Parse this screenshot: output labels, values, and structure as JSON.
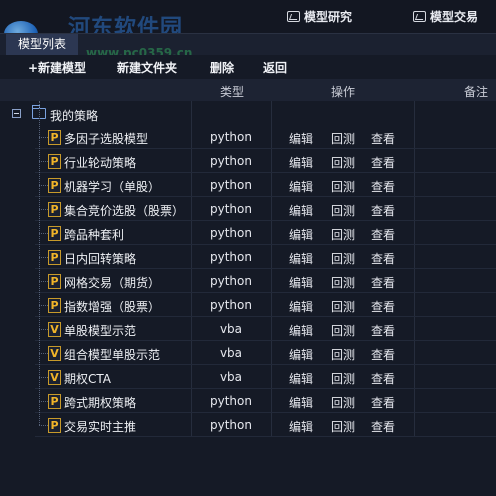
{
  "topbar": {
    "watermark_title": "河东软件园",
    "watermark_url": "www.pc0359.cn",
    "nav": [
      {
        "label": "模型研究"
      },
      {
        "label": "模型交易"
      }
    ]
  },
  "tabs": [
    {
      "label": "模型列表"
    }
  ],
  "toolbar": {
    "new_model": "+新建模型",
    "new_folder": "新建文件夹",
    "delete": "删除",
    "back": "返回"
  },
  "table": {
    "headers": {
      "type": "类型",
      "ops": "操作",
      "note": "备注"
    },
    "folder": {
      "label": "我的策略"
    },
    "ops_labels": {
      "edit": "编辑",
      "back": "回测",
      "view": "查看"
    },
    "rows": [
      {
        "icon": "P",
        "name": "多因子选股模型",
        "type": "python"
      },
      {
        "icon": "P",
        "name": "行业轮动策略",
        "type": "python"
      },
      {
        "icon": "P",
        "name": "机器学习（单股）",
        "type": "python"
      },
      {
        "icon": "P",
        "name": "集合竞价选股（股票）",
        "type": "python"
      },
      {
        "icon": "P",
        "name": "跨品种套利",
        "type": "python"
      },
      {
        "icon": "P",
        "name": "日内回转策略",
        "type": "python"
      },
      {
        "icon": "P",
        "name": "网格交易（期货）",
        "type": "python"
      },
      {
        "icon": "P",
        "name": "指数增强（股票）",
        "type": "python"
      },
      {
        "icon": "V",
        "name": "单股模型示范",
        "type": "vba"
      },
      {
        "icon": "V",
        "name": "组合模型单股示范",
        "type": "vba"
      },
      {
        "icon": "V",
        "name": "期权CTA",
        "type": "vba"
      },
      {
        "icon": "P",
        "name": "跨式期权策略",
        "type": "python"
      },
      {
        "icon": "P",
        "name": "交易实时主推",
        "type": "python"
      }
    ]
  },
  "colors": {
    "background": "#151a26",
    "header_bg": "#1d2333",
    "tab_active": "#2c3752",
    "file_icon": "#f0b429"
  }
}
